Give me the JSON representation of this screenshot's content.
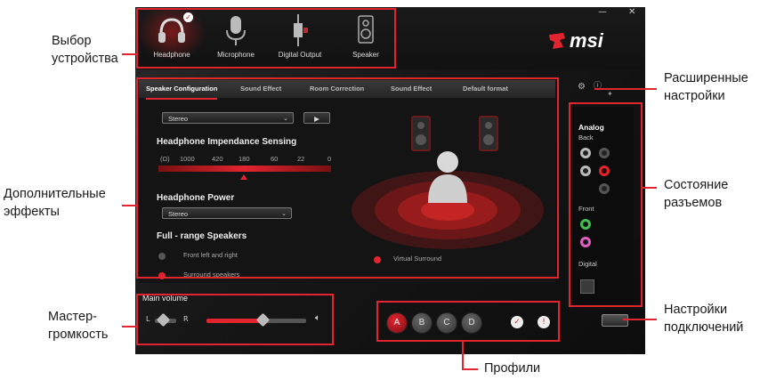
{
  "app": {
    "brand": "msi",
    "window_controls": {
      "minimize": "—",
      "close": "✕"
    },
    "devices": [
      {
        "label": "Headphone",
        "icon": "headphone-icon",
        "selected": true
      },
      {
        "label": "Microphone",
        "icon": "microphone-icon",
        "selected": false
      },
      {
        "label": "Digital Output",
        "icon": "digital-output-icon",
        "selected": false
      },
      {
        "label": "Speaker",
        "icon": "speaker-icon",
        "selected": false
      }
    ],
    "tabs": [
      "Speaker Configuration",
      "Sound Effect",
      "Room Correction",
      "Sound Effect",
      "Default format"
    ],
    "speaker_config": {
      "mode_select": "Stereo",
      "play_button": "▶",
      "impedance_title": "Headphone Impendance Sensing",
      "impedance_unit": "(Ω)",
      "impedance_scale": [
        "1000",
        "420",
        "180",
        "60",
        "22",
        "0"
      ],
      "impedance_selected_index": 2,
      "power_title": "Headphone Power",
      "power_select": "Stereo",
      "fullrange_title": "Full - range Speakers",
      "options": [
        {
          "label": "Front left and right",
          "active": false
        },
        {
          "label": "Surround speakers",
          "active": true
        }
      ],
      "virtual_surround": {
        "label": "Virtual Surround",
        "active": true
      }
    },
    "jacks": {
      "analog_title": "Analog",
      "back_label": "Back",
      "front_label": "Front",
      "digital_label": "Digital"
    },
    "master_volume": {
      "title": "Main volume",
      "left": "L",
      "right": "R",
      "level": 0.55,
      "balance": 0.5
    },
    "profiles": [
      "A",
      "B",
      "C",
      "D"
    ],
    "active_profile": "A"
  },
  "callouts": {
    "device_select": "Выбор устройства",
    "advanced_settings": "Расширенные настройки",
    "extra_effects": "Дополнительные эффекты",
    "jack_status": "Состояние разъемов",
    "master_volume": "Мастер-громкость",
    "connection_settings": "Настройки подключений",
    "profiles": "Профили"
  },
  "colors": {
    "accent": "#e2242f",
    "jack_green": "#3fbf4f",
    "jack_pink": "#e060c0"
  }
}
